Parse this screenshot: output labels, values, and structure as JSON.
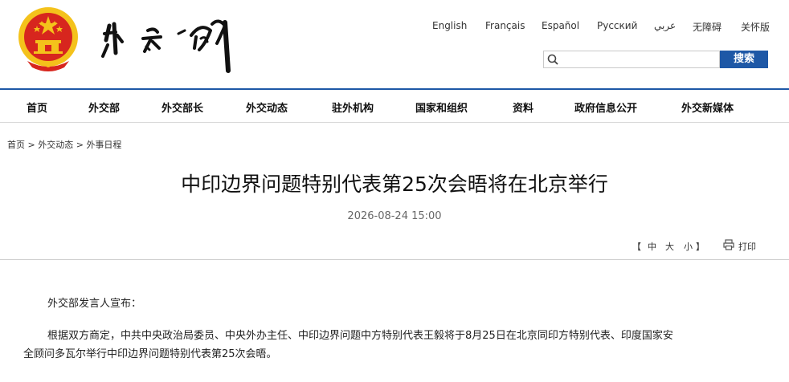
{
  "languages": [
    "English",
    "Français",
    "Español",
    "Русский",
    "عربي",
    "无障碍",
    "关怀版"
  ],
  "search": {
    "placeholder": "",
    "button_label": "搜索"
  },
  "nav": [
    "首页",
    "外交部",
    "外交部长",
    "外交动态",
    "驻外机构",
    "国家和组织",
    "资料",
    "政府信息公开",
    "外交新媒体"
  ],
  "breadcrumb": [
    "首页",
    ">",
    "外交动态",
    ">",
    "外事日程"
  ],
  "article": {
    "title": "中印边界问题特别代表第25次会晤将在北京举行",
    "date": "2026-08-24 15:00",
    "paragraph1": "外交部发言人宣布：",
    "paragraph2_line1": "根据双方商定，中共中央政治局委员、中央外办主任、中印边界问题中方特别代表王毅将于8月25日在北京同印方特别代表、印度国家安",
    "paragraph2_line2": "全顾问多瓦尔举行中印边界问题特别代表第25次会晤。"
  },
  "font_size": {
    "open": "【",
    "medium": "中",
    "large": "大",
    "small": "小",
    "close": "】"
  },
  "print_label": "打印",
  "colors": {
    "brand_blue": "#1e58a6",
    "emblem_red": "#d7261e",
    "emblem_gold": "#f4c21b"
  },
  "icons": {
    "search": "search-icon",
    "print": "printer-icon",
    "emblem": "national-emblem-icon"
  }
}
